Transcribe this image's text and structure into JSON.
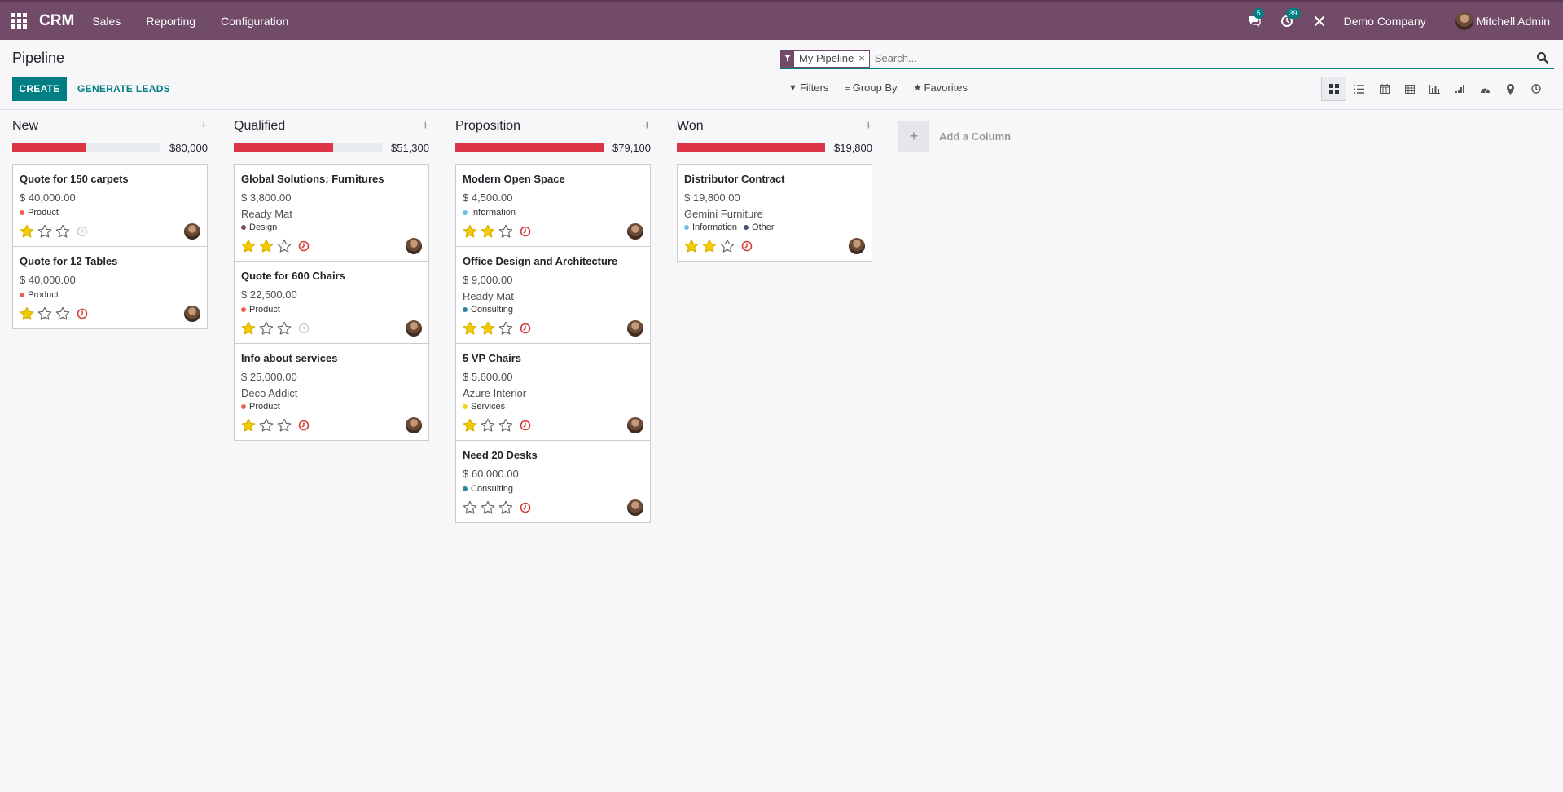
{
  "navbar": {
    "brand": "CRM",
    "menu": [
      "Sales",
      "Reporting",
      "Configuration"
    ],
    "messages_count": "5",
    "activities_count": "39",
    "company": "Demo Company",
    "user": "Mitchell Admin"
  },
  "page": {
    "title": "Pipeline",
    "create_label": "CREATE",
    "generate_label": "GENERATE LEADS"
  },
  "search": {
    "facet": "My Pipeline",
    "placeholder": "Search...",
    "filters_label": "Filters",
    "groupby_label": "Group By",
    "favorites_label": "Favorites"
  },
  "views": [
    "kanban",
    "list",
    "calendar",
    "pivot",
    "graph",
    "cohort",
    "dashboard",
    "map",
    "activity"
  ],
  "colors": {
    "brand": "#714b67",
    "accent": "#017e84",
    "progress": "#dc3545",
    "star": "#f3cc00",
    "overdue": "#d23f3a"
  },
  "kanban": {
    "columns": [
      {
        "name": "New",
        "total": "$80,000",
        "progress": 0.5,
        "cards": [
          {
            "title": "Quote for 150 carpets",
            "amount": "$ 40,000.00",
            "company": "",
            "tags": [
              {
                "label": "Product",
                "color": "#f06050"
              }
            ],
            "stars": 1,
            "activity": "none"
          },
          {
            "title": "Quote for 12 Tables",
            "amount": "$ 40,000.00",
            "company": "",
            "tags": [
              {
                "label": "Product",
                "color": "#f06050"
              }
            ],
            "stars": 1,
            "activity": "overdue"
          }
        ]
      },
      {
        "name": "Qualified",
        "total": "$51,300",
        "progress": 0.67,
        "cards": [
          {
            "title": "Global Solutions: Furnitures",
            "amount": "$ 3,800.00",
            "company": "Ready Mat",
            "tags": [
              {
                "label": "Design",
                "color": "#814968"
              }
            ],
            "stars": 2,
            "activity": "overdue"
          },
          {
            "title": "Quote for 600 Chairs",
            "amount": "$ 22,500.00",
            "company": "",
            "tags": [
              {
                "label": "Product",
                "color": "#f06050"
              }
            ],
            "stars": 1,
            "activity": "none"
          },
          {
            "title": "Info about services",
            "amount": "$ 25,000.00",
            "company": "Deco Addict",
            "tags": [
              {
                "label": "Product",
                "color": "#f06050"
              }
            ],
            "stars": 1,
            "activity": "overdue"
          }
        ]
      },
      {
        "name": "Proposition",
        "total": "$79,100",
        "progress": 1.0,
        "cards": [
          {
            "title": "Modern Open Space",
            "amount": "$ 4,500.00",
            "company": "",
            "tags": [
              {
                "label": "Information",
                "color": "#6cc1ed"
              }
            ],
            "stars": 2,
            "activity": "overdue"
          },
          {
            "title": "Office Design and Architecture",
            "amount": "$ 9,000.00",
            "company": "Ready Mat",
            "tags": [
              {
                "label": "Consulting",
                "color": "#30859a"
              }
            ],
            "stars": 2,
            "activity": "overdue"
          },
          {
            "title": "5 VP Chairs",
            "amount": "$ 5,600.00",
            "company": "Azure Interior",
            "tags": [
              {
                "label": "Services",
                "color": "#f7cd1f"
              }
            ],
            "stars": 1,
            "activity": "overdue"
          },
          {
            "title": "Need 20 Desks",
            "amount": "$ 60,000.00",
            "company": "",
            "tags": [
              {
                "label": "Consulting",
                "color": "#30859a"
              }
            ],
            "stars": 0,
            "activity": "overdue"
          }
        ]
      },
      {
        "name": "Won",
        "total": "$19,800",
        "progress": 1.0,
        "cards": [
          {
            "title": "Distributor Contract",
            "amount": "$ 19,800.00",
            "company": "Gemini Furniture",
            "tags": [
              {
                "label": "Information",
                "color": "#6cc1ed"
              },
              {
                "label": "Other",
                "color": "#475577"
              }
            ],
            "stars": 2,
            "activity": "overdue"
          }
        ]
      }
    ],
    "add_column_label": "Add a Column"
  }
}
